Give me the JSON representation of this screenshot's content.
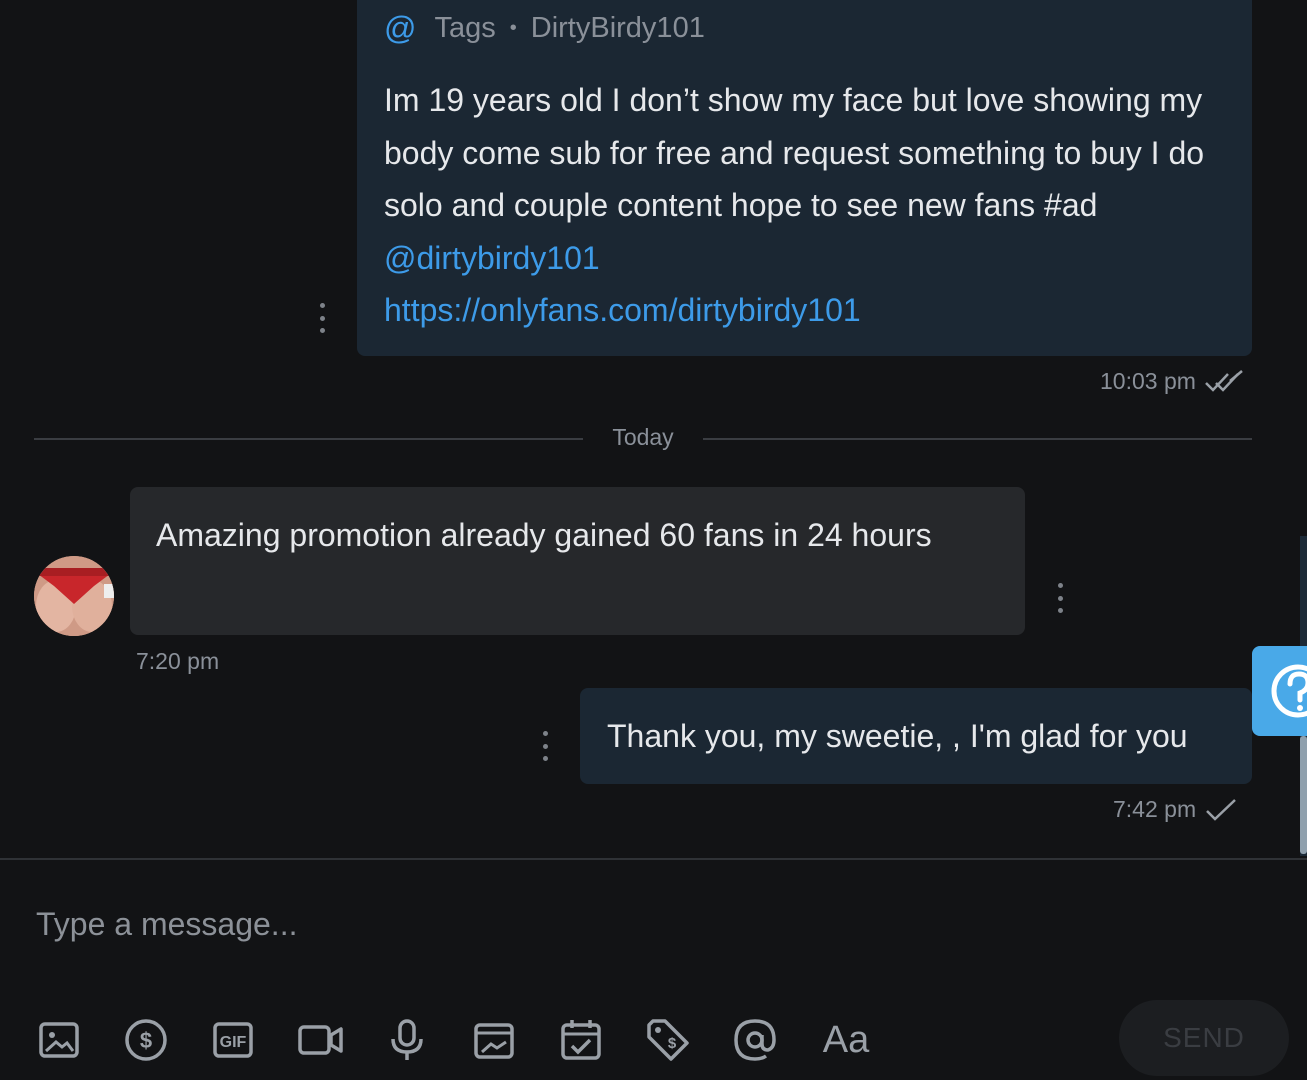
{
  "colors": {
    "background": "#121315",
    "outgoing_bubble": "#1b2733",
    "incoming_bubble": "#26282b",
    "link": "#3d9be9",
    "muted_text": "#8a9099",
    "help_tab": "#49a9e8"
  },
  "messages": {
    "tagged": {
      "tags_icon": "at-icon",
      "tags_label": "Tags",
      "separator": "•",
      "tagged_user": "DirtyBirdy101",
      "text": "Im 19 years old I don’t show my face but love showing my body come sub for free and request something to buy I do solo and couple content hope to see new fans #ad",
      "mention": "@dirtybirdy101",
      "link": "https://onlyfans.com/dirtybirdy101",
      "time": "10:03 pm",
      "status_icon": "double-check-icon"
    },
    "incoming": {
      "text": "Amazing promotion already gained 60 fans in 24 hours",
      "time": "7:20 pm"
    },
    "reply": {
      "text": "Thank you, my sweetie, , I'm glad for you",
      "time": "7:42 pm",
      "status_icon": "check-icon"
    }
  },
  "divider": {
    "label": "Today"
  },
  "composer": {
    "placeholder": "Type a message...",
    "send_label": "SEND",
    "tools": [
      "image-icon",
      "dollar-icon",
      "gif-icon",
      "video-icon",
      "microphone-icon",
      "media-vault-icon",
      "calendar-icon",
      "price-tag-icon",
      "at-icon"
    ],
    "text_format_label": "Aa"
  }
}
